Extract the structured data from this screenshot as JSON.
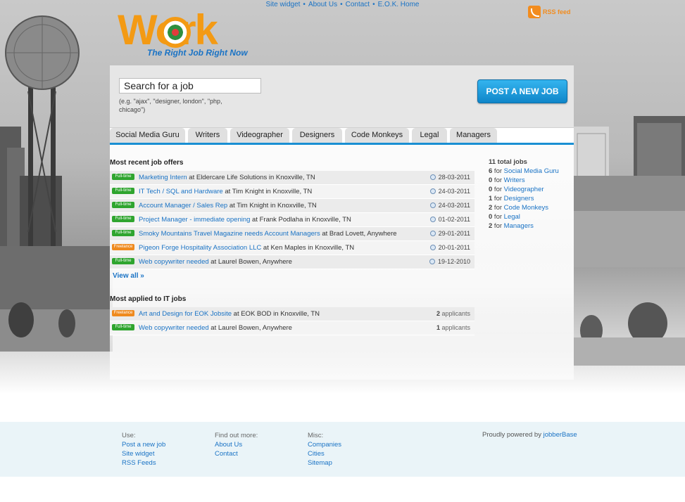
{
  "topnav": {
    "links": [
      "Site widget",
      "About Us",
      "Contact",
      "E.O.K. Home"
    ],
    "separator": "•"
  },
  "rss": {
    "label": "RSS feed"
  },
  "logo": {
    "word": "Work",
    "tagline": "The Right Job Right Now"
  },
  "search": {
    "value": "Search for a job",
    "hint": "(e.g. \"ajax\", \"designer, london\", \"php, chicago\")"
  },
  "post_button": "POST A NEW JOB",
  "tabs": [
    "Social Media Guru",
    "Writers",
    "Videographer",
    "Designers",
    "Code Monkeys",
    "Legal",
    "Managers"
  ],
  "recent": {
    "title": "Most recent job offers",
    "jobs": [
      {
        "type": "Full-time",
        "title": "Marketing Intern",
        "company": "Eldercare Life Solutions",
        "location": "Knoxville, TN",
        "date": "28-03-2011"
      },
      {
        "type": "Full-time",
        "title": "IT Tech / SQL and Hardware",
        "company": "Tim Knight",
        "location": "Knoxville, TN",
        "date": "24-03-2011"
      },
      {
        "type": "Full-time",
        "title": "Account Manager / Sales Rep",
        "company": "Tim Knight",
        "location": "Knoxville, TN",
        "date": "24-03-2011"
      },
      {
        "type": "Full-time",
        "title": "Project Manager - immediate opening",
        "company": "Frank Podlaha",
        "location": "Knoxville, TN",
        "date": "01-02-2011"
      },
      {
        "type": "Full-time",
        "title": "Smoky Mountains Travel Magazine needs Account Managers",
        "company": "Brad Lovett",
        "location": "Anywhere",
        "date": "29-01-2011"
      },
      {
        "type": "Freelance",
        "title": "Pigeon Forge Hospitality Association LLC",
        "company": "Ken Maples",
        "location": "Knoxville, TN",
        "date": "20-01-2011"
      },
      {
        "type": "Full-time",
        "title": "Web copywriter needed",
        "company": "Laurel Bowen",
        "location": "Anywhere",
        "date": "19-12-2010"
      }
    ],
    "view_all": "View all »"
  },
  "applied": {
    "title": "Most applied to IT jobs",
    "jobs": [
      {
        "type": "Freelance",
        "title": "Art and Design for EOK Jobsite",
        "company": "EOK BOD",
        "location": "Knoxville, TN",
        "count": "2",
        "unit": "applicants"
      },
      {
        "type": "Full-time",
        "title": "Web copywriter needed",
        "company": "Laurel Bowen",
        "location": "Anywhere",
        "count": "1",
        "unit": "applicants"
      }
    ]
  },
  "stats": {
    "total": "11 total jobs",
    "categories": [
      {
        "count": "6",
        "name": "Social Media Guru"
      },
      {
        "count": "0",
        "name": "Writers"
      },
      {
        "count": "0",
        "name": "Videographer"
      },
      {
        "count": "1",
        "name": "Designers"
      },
      {
        "count": "2",
        "name": "Code Monkeys"
      },
      {
        "count": "0",
        "name": "Legal"
      },
      {
        "count": "2",
        "name": "Managers"
      }
    ]
  },
  "footer": {
    "cols": [
      {
        "heading": "Use:",
        "links": [
          "Post a new job",
          "Site widget",
          "RSS Feeds"
        ]
      },
      {
        "heading": "Find out more:",
        "links": [
          "About Us",
          "Contact"
        ]
      },
      {
        "heading": "Misc:",
        "links": [
          "Companies",
          "Cities",
          "Sitemap"
        ]
      }
    ],
    "powered_prefix": "Proudly powered by",
    "powered_link": "jobberBase"
  },
  "colors": {
    "accent": "#1a73c5",
    "fulltime": "#2fa52f",
    "freelance": "#ef8a1e",
    "logo": "#f39a14",
    "tab_bar": "#1a8fd3"
  }
}
